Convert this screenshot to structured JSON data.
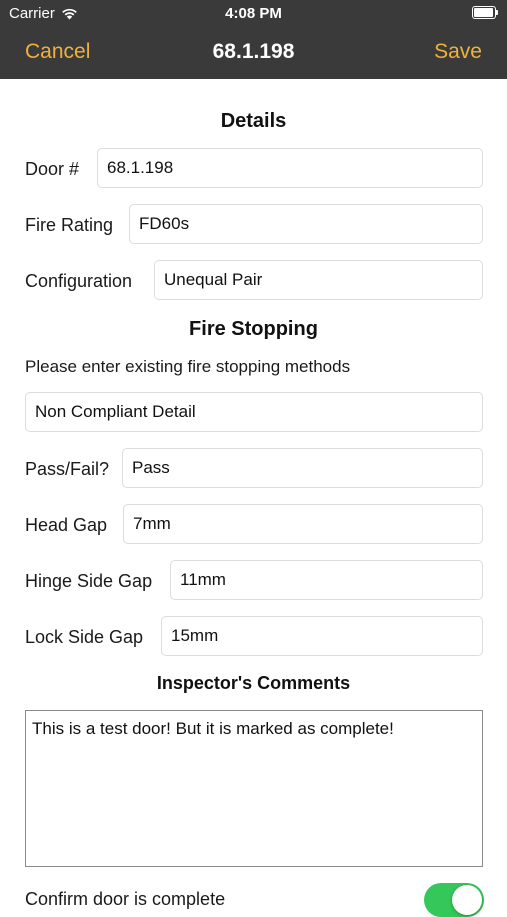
{
  "status_bar": {
    "carrier": "Carrier",
    "time": "4:08 PM"
  },
  "nav": {
    "cancel_label": "Cancel",
    "title": "68.1.198",
    "save_label": "Save"
  },
  "details": {
    "heading": "Details",
    "door_label": "Door #",
    "door_value": "68.1.198",
    "fire_rating_label": "Fire Rating",
    "fire_rating_value": "FD60s",
    "configuration_label": "Configuration",
    "configuration_value": "Unequal Pair"
  },
  "fire_stopping": {
    "heading": "Fire Stopping",
    "hint": "Please enter existing fire stopping methods",
    "method_value": "Non Compliant Detail",
    "pass_fail_label": "Pass/Fail?",
    "pass_fail_value": "Pass",
    "head_gap_label": "Head Gap",
    "head_gap_value": "7mm",
    "hinge_gap_label": "Hinge Side Gap",
    "hinge_gap_value": "11mm",
    "lock_gap_label": "Lock Side Gap",
    "lock_gap_value": "15mm"
  },
  "comments": {
    "heading": "Inspector's Comments",
    "text": "This is a test door! But it is marked as complete!"
  },
  "confirm": {
    "label": "Confirm door is complete",
    "checked": true
  },
  "colors": {
    "accent": "#f0b13a",
    "header": "#3a3a3a",
    "toggle_on": "#34c759"
  }
}
